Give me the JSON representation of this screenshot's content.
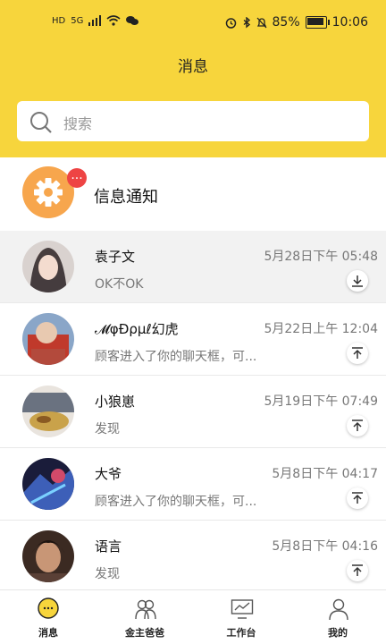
{
  "status_bar": {
    "network": "HD",
    "net_type": "5G",
    "battery": "85%",
    "time": "10:06"
  },
  "header": {
    "title": "消息"
  },
  "search": {
    "placeholder": "搜索"
  },
  "notice": {
    "label": "信息通知",
    "badge": "..."
  },
  "conversations": [
    {
      "name": "袁子文",
      "time": "5月28日下午 05:48",
      "message": "OK不OK",
      "selected": true,
      "pin_icon": "download-icon"
    },
    {
      "name": "𝓜φÐρμℓ幻虎",
      "time": "5月22日上午 12:04",
      "message": "顾客进入了你的聊天框，可...",
      "selected": false,
      "pin_icon": "pin-top-icon"
    },
    {
      "name": "小狼崽",
      "time": "5月19日下午 07:49",
      "message": "发现",
      "selected": false,
      "pin_icon": "pin-top-icon"
    },
    {
      "name": "大爷",
      "time": "5月8日下午 04:17",
      "message": "顾客进入了你的聊天框，可...",
      "selected": false,
      "pin_icon": "pin-top-icon"
    },
    {
      "name": "语言",
      "time": "5月8日下午 04:16",
      "message": "发现",
      "selected": false,
      "pin_icon": "pin-top-icon"
    }
  ],
  "tabbar": [
    {
      "label": "消息",
      "icon": "chat-bubble-icon",
      "active": true
    },
    {
      "label": "金主爸爸",
      "icon": "people-icon",
      "active": false
    },
    {
      "label": "工作台",
      "icon": "monitor-chart-icon",
      "active": false
    },
    {
      "label": "我的",
      "icon": "user-icon",
      "active": false
    }
  ],
  "colors": {
    "accent": "#f7d53c",
    "gear": "#f7a64d",
    "badge": "#ee4444"
  }
}
